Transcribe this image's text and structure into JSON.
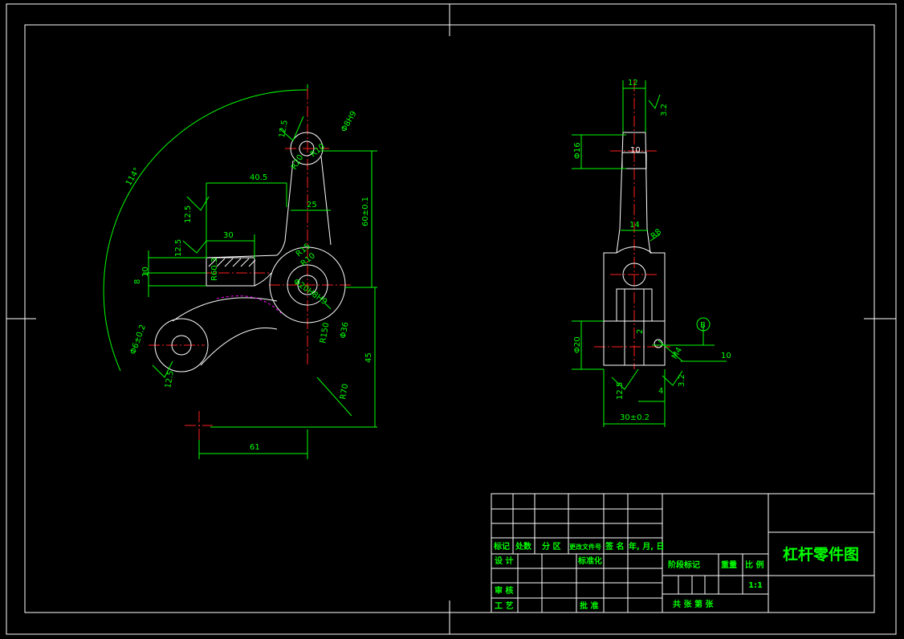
{
  "drawing_title": "杠杆零件图",
  "scale": "1:1",
  "title_block": {
    "row_labels": [
      "标记",
      "处数",
      "分 区",
      "更改文件号",
      "签 名",
      "年, 月, 日"
    ],
    "design": "设 计",
    "standardize": "标准化",
    "check": "审 核",
    "process": "工 艺",
    "approve": "批 准",
    "stage_mark": "阶段标记",
    "weight": "重量",
    "scale_label": "比 例",
    "sheets": "共   张   第   张"
  },
  "front_view": {
    "dim_114": "114°",
    "dim_12_5_a": "12.5",
    "dim_phi8h9": "Φ8H9",
    "dim_r10_top": "R10",
    "dim_r20": "R20",
    "dim_40_5": "40.5",
    "dim_25": "25",
    "dim_12_5_b": "12.5",
    "dim_30": "30",
    "dim_12_5_c": "12.5",
    "dim_10": "10",
    "dim_8": "8",
    "dim_r60_3": "R60.3",
    "dim_r15": "R15",
    "dim_r10_mid": "R10",
    "dim_phi20": "Φ20H8H9",
    "dim_r150": "R150",
    "dim_phi36": "Φ36",
    "dim_60": "60±0.1",
    "dim_45": "45",
    "dim_r70": "R70",
    "dim_phi6": "Φ6±0.2",
    "dim_12_5_d": "12.5",
    "dim_61": "61"
  },
  "side_view": {
    "dim_12_top": "12",
    "dim_3_2": "3.2",
    "dim_phi16": "Φ16",
    "dim_10": "10",
    "dim_14": "14",
    "dim_r8": "R8",
    "dim_phi20": "Φ20",
    "dim_2": "2",
    "dim_m4": "M4",
    "dim_10_tol": "10",
    "dim_12_5": "12.5",
    "dim_4": "4",
    "dim_3_2_b": "3.2",
    "dim_30": "30±0.2",
    "datum": "B"
  }
}
